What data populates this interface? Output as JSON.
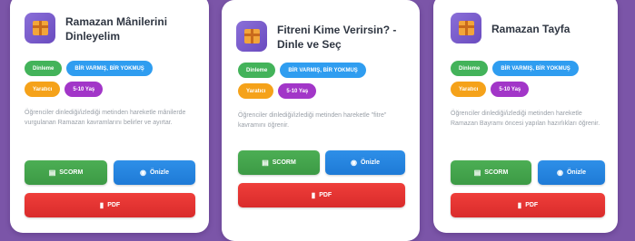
{
  "cards": [
    {
      "title": "Ramazan Mânilerini Dinleyelim",
      "tags": [
        "Dinleme",
        "BİR VARMIŞ, BİR YOKMUŞ",
        "Yaratıcı",
        "5-10 Yaş"
      ],
      "description": "Öğrenciler dinlediği/izlediği metinden hareketle mânilerde vurgulanan Ramazan kavramlarını belirler ve ayırtar.",
      "buttons": {
        "scorm": "SCORM",
        "preview": "Önizle",
        "pdf": "PDF"
      }
    },
    {
      "title": "Fitreni Kime Verirsin? - Dinle ve Seç",
      "tags": [
        "Dinleme",
        "BİR VARMIŞ, BİR YOKMUŞ",
        "Yaratıcı",
        "5-10 Yaş"
      ],
      "description": "Öğrenciler dinlediği/izlediği metinden hareketle \"fitre\" kavramını öğrenir.",
      "buttons": {
        "scorm": "SCORM",
        "preview": "Önizle",
        "pdf": "PDF"
      }
    },
    {
      "title": "Ramazan Tayfa",
      "tags": [
        "Dinleme",
        "BİR VARMIŞ, BİR YOKMUŞ",
        "Yaratıcı",
        "5-10 Yaş"
      ],
      "description": "Öğrenciler dinlediği/izlediği metinden hareketle Ramazan Bayramı öncesi yapılan hazırlıkları öğrenir.",
      "buttons": {
        "scorm": "SCORM",
        "preview": "Önizle",
        "pdf": "PDF"
      }
    }
  ],
  "icons": {
    "card_icon": "gift-icon",
    "scorm_icon": "package-icon",
    "preview_icon": "eye-icon",
    "pdf_icon": "document-icon"
  },
  "colors": {
    "background": "#7b55a8",
    "tag_green": "#43b35a",
    "tag_blue": "#2f9df0",
    "tag_orange": "#f5a21a",
    "tag_purple": "#a236c8",
    "button_green": "#3c9a45",
    "button_blue": "#1e7ad6",
    "button_red": "#d92b2b"
  }
}
